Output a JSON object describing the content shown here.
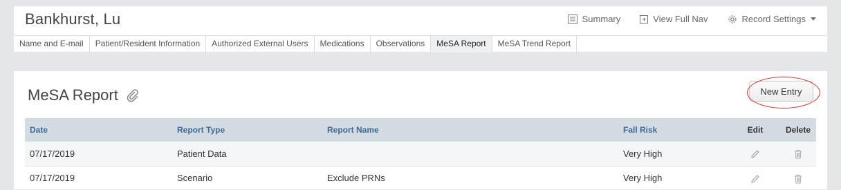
{
  "patient": {
    "name": "Bankhurst, Lu"
  },
  "header_actions": [
    {
      "label": "Summary",
      "icon": "list-icon"
    },
    {
      "label": "View Full Nav",
      "icon": "nav-arrow-icon"
    },
    {
      "label": "Record Settings",
      "icon": "gear-icon",
      "dropdown": true
    }
  ],
  "tabs": [
    {
      "label": "Name and E-mail",
      "active": false
    },
    {
      "label": "Patient/Resident Information",
      "active": false
    },
    {
      "label": "Authorized External Users",
      "active": false
    },
    {
      "label": "Medications",
      "active": false
    },
    {
      "label": "Observations",
      "active": false
    },
    {
      "label": "MeSA Report",
      "active": true
    },
    {
      "label": "MeSA Trend Report",
      "active": false
    }
  ],
  "section": {
    "title": "MeSA Report",
    "title_icon": "link-icon",
    "new_entry_label": "New Entry",
    "highlight_color": "#e0281e"
  },
  "table": {
    "columns": [
      "Date",
      "Report Type",
      "Report Name",
      "Fall Risk",
      "Edit",
      "Delete"
    ],
    "rows": [
      {
        "date": "07/17/2019",
        "report_type": "Patient Data",
        "report_name": "",
        "fall_risk": "Very High"
      },
      {
        "date": "07/17/2019",
        "report_type": "Scenario",
        "report_name": "Exclude PRNs",
        "fall_risk": "Very High"
      }
    ]
  },
  "colors": {
    "page_bg": "#e4e6ea",
    "header_text": "#3c6b94",
    "table_header_bg": "#d4dbe3"
  }
}
